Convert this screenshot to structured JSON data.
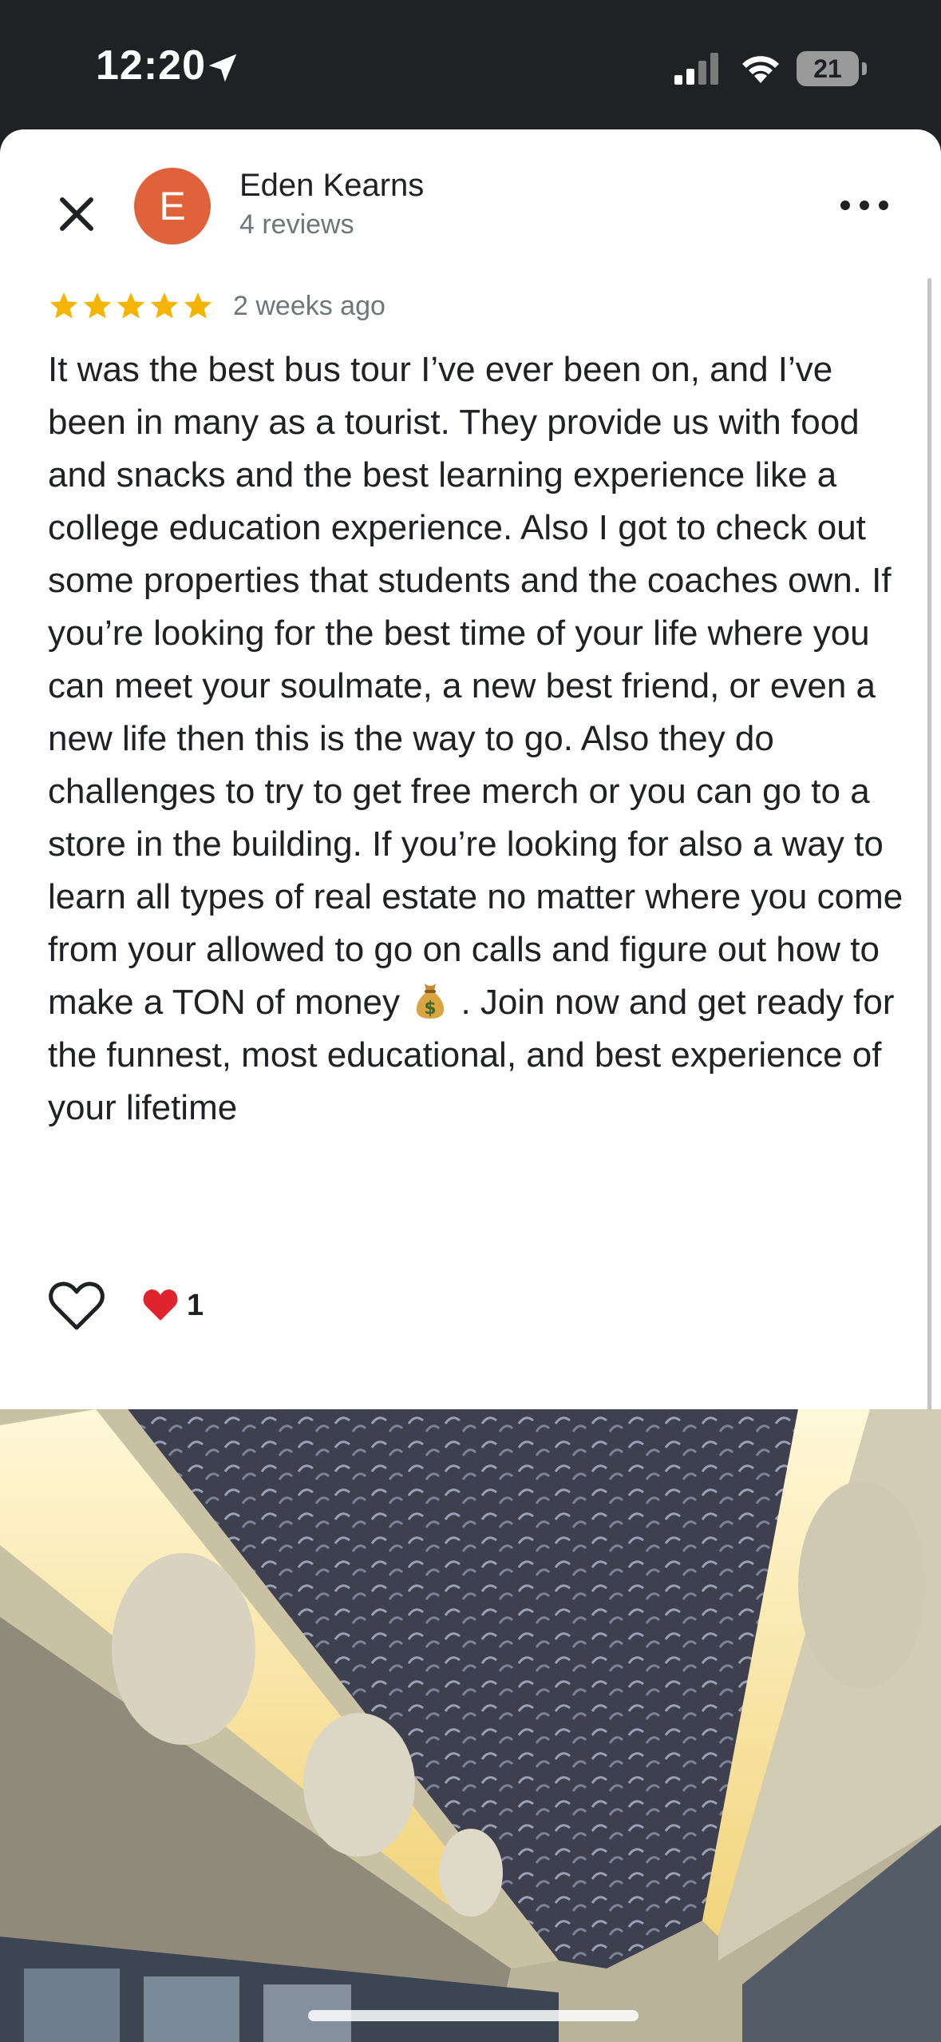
{
  "status_bar": {
    "time": "12:20",
    "battery": "21",
    "icons": [
      "location-arrow-icon",
      "cellular-signal-icon",
      "wifi-icon",
      "battery-icon"
    ]
  },
  "review": {
    "author_initial": "E",
    "author_name": "Eden Kearns",
    "author_review_count": "4 reviews",
    "rating": 5,
    "max_rating": 5,
    "date": "2 weeks ago",
    "text_before_emoji": "It was the best bus tour I’ve ever been on, and I’ve been in many as a tourist. They provide us with food and snacks and the best learning experience like a college education experience. Also I got to check out some properties that students and the coaches own. If you’re looking for the best time of your life where you can meet your soulmate, a new best friend, or even a new life then this is the way to go. Also they do challenges to try to get free merch or you can go to a store in the building. If you’re looking for also a way to learn all types of real estate no matter where you come from your allowed to go on calls and figure out how to make a TON of money",
    "text_after_emoji": ". Join now and get ready for the funnest, most educational, and best experience of your lifetime",
    "emoji": "money-bag-icon",
    "reaction_count": "1"
  },
  "colors": {
    "status_bar_bg": "#202124",
    "avatar_bg": "#e0623a",
    "star": "#f4b400",
    "text_primary": "#202124",
    "text_secondary": "#70757a",
    "heart_red": "#e0242e"
  }
}
